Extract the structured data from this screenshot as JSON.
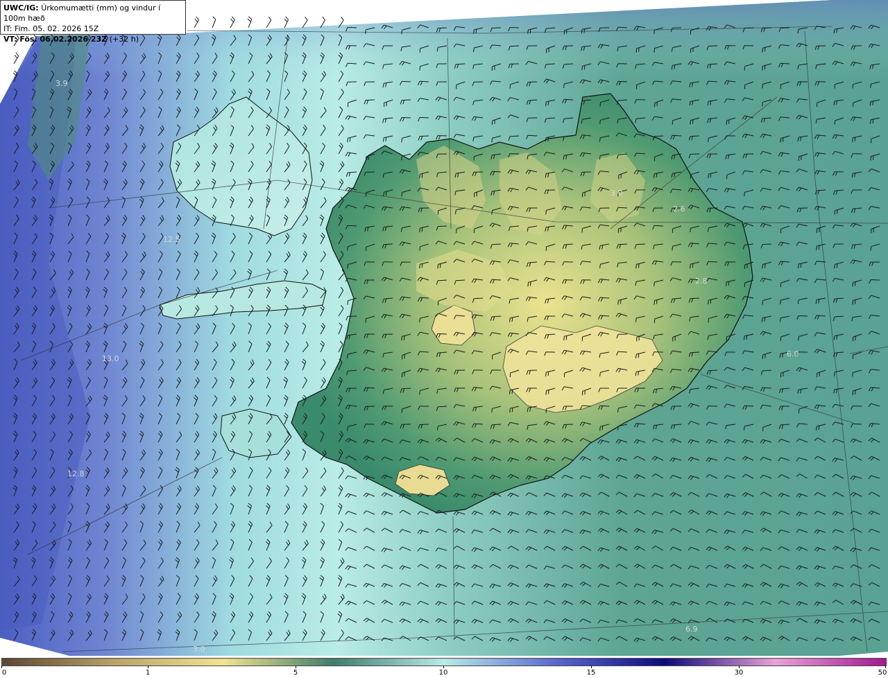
{
  "header": {
    "line1_prefix": "UWC/IG:",
    "line1_text": "Úrkomumætti (mm) og vindur í 100m hæð",
    "line2": "IT: Fim. 05. 02. 2026 15Z",
    "line3_prefix": "VT:",
    "line3_text": "Fös. 06.02.2026 23Z",
    "line3_suffix": "(+32 h)"
  },
  "colorbar": {
    "ticks": [
      "0",
      "1",
      "5",
      "10",
      "15",
      "30",
      "50"
    ],
    "colors": [
      "#5a4630",
      "#b9a06a",
      "#f2e38f",
      "#3f7d6c",
      "#b8eae6",
      "#5b6ad0",
      "#0d0b78",
      "#e7a2d8",
      "#a3188f"
    ]
  },
  "map_values": [
    "3.9",
    "12.5",
    "12.5",
    "13.0",
    "12.8",
    "3.0",
    "2.6",
    "2.8",
    "6.0",
    "6.9",
    "3.0"
  ],
  "colors": {
    "ocean_west": "#4f63c4",
    "ocean_mid": "#a8e2de",
    "ocean_east": "#4f9a8a",
    "land_low": "#3e8a6f",
    "land_high": "#e6de8c",
    "coast": "#111111",
    "barb": "#1a1a1a"
  }
}
